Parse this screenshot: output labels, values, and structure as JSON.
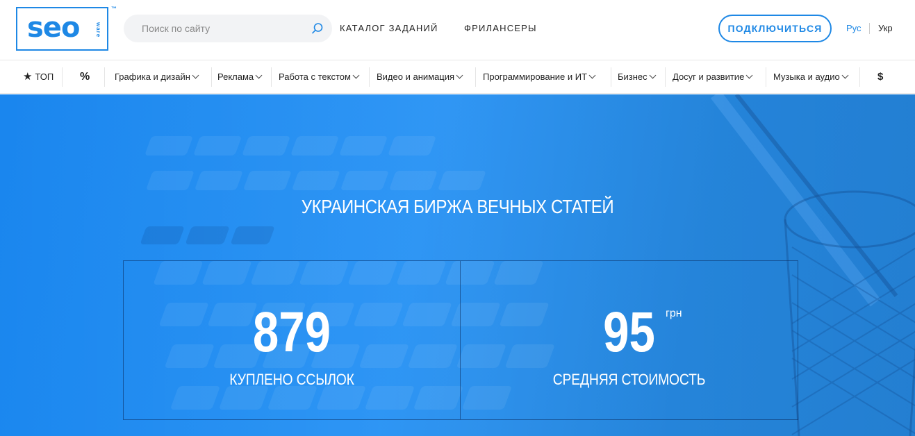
{
  "brand": {
    "logo_text": "seo",
    "logo_sub": "ware",
    "tm": "™"
  },
  "search": {
    "placeholder": "Поиск по сайту",
    "icon": "search-icon"
  },
  "top_nav": {
    "catalog": "КАТАЛОГ ЗАДАНИЙ",
    "freelancers": "ФРИЛАНСЕРЫ"
  },
  "header": {
    "connect": "ПОДКЛЮЧИТЬСЯ",
    "lang_ru": "Рус",
    "lang_ua": "Укр"
  },
  "categories": {
    "top": "ТОП",
    "discount": "%",
    "items": [
      "Графика и дизайн",
      "Реклама",
      "Работа с текстом",
      "Видео и анимация",
      "Программирование и ИТ",
      "Бизнес",
      "Досуг и развитие",
      "Музыка и аудио"
    ],
    "currency": "$"
  },
  "hero": {
    "title": "УКРАИНСКАЯ БИРЖА ВЕЧНЫХ СТАТЕЙ",
    "stats": [
      {
        "value": "879",
        "unit": "",
        "label": "КУПЛЕНО ССЫЛОК"
      },
      {
        "value": "95",
        "unit": "грн",
        "label": "СРЕДНЯЯ СТОИМОСТЬ"
      }
    ]
  },
  "colors": {
    "accent": "#1e88e5",
    "hero_bg": "#2390f4"
  }
}
